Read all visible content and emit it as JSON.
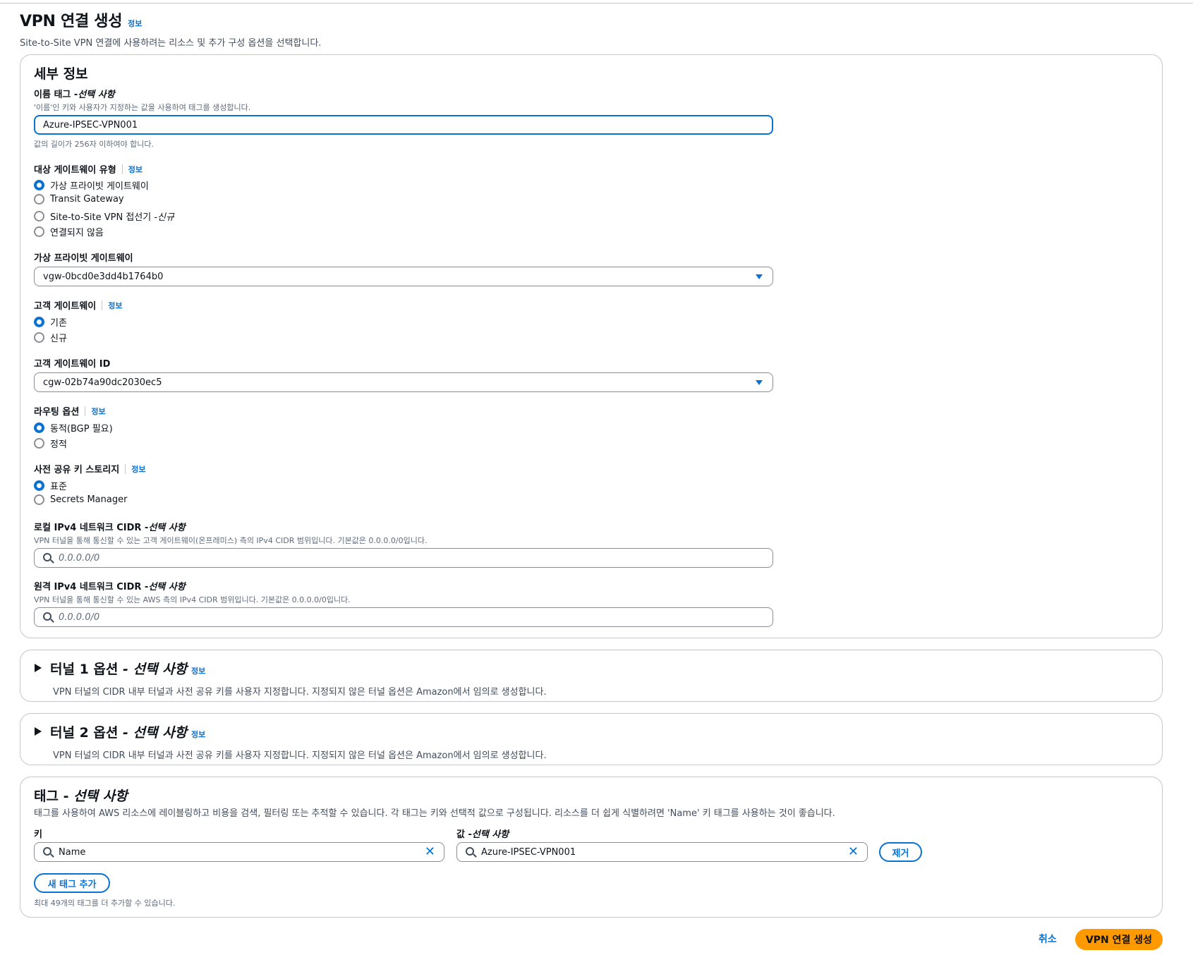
{
  "page": {
    "title": "VPN 연결 생성",
    "info": "정보",
    "description": "Site-to-Site VPN 연결에 사용하려는 리소스 및 추가 구성 옵션을 선택합니다."
  },
  "details": {
    "heading": "세부 정보",
    "name_tag": {
      "label": "이름 태그 - ",
      "optional": "선택 사항",
      "hint": "'이름'인 키와 사용자가 지정하는 값을 사용하여 태그를 생성합니다.",
      "value": "Azure-IPSEC-VPN001",
      "constraint": "값의 길이가 256자 이하여야 합니다."
    },
    "target_gateway_type": {
      "label": "대상 게이트웨이 유형",
      "info": "정보",
      "options": [
        {
          "label": "가상 프라이빗 게이트웨이",
          "suffix": "",
          "checked": true
        },
        {
          "label": "Transit Gateway",
          "suffix": "",
          "checked": false
        },
        {
          "label": "Site-to-Site VPN 접선기 - ",
          "suffix": "신규",
          "checked": false
        },
        {
          "label": "연결되지 않음",
          "suffix": "",
          "checked": false
        }
      ]
    },
    "vgw": {
      "label": "가상 프라이빗 게이트웨이",
      "value": "vgw-0bcd0e3dd4b1764b0"
    },
    "customer_gateway": {
      "label": "고객 게이트웨이",
      "info": "정보",
      "options": [
        {
          "label": "기존",
          "checked": true
        },
        {
          "label": "신규",
          "checked": false
        }
      ]
    },
    "cgw_id": {
      "label": "고객 게이트웨이 ID",
      "value": "cgw-02b74a90dc2030ec5"
    },
    "routing": {
      "label": "라우팅 옵션",
      "info": "정보",
      "options": [
        {
          "label": "동적(BGP 필요)",
          "checked": true
        },
        {
          "label": "정적",
          "checked": false
        }
      ]
    },
    "psk_storage": {
      "label": "사전 공유 키 스토리지",
      "info": "정보",
      "options": [
        {
          "label": "표준",
          "checked": true
        },
        {
          "label": "Secrets Manager",
          "checked": false
        }
      ]
    },
    "local_cidr": {
      "label": "로컬 IPv4 네트워크 CIDR - ",
      "optional": "선택 사항",
      "hint": "VPN 터널을 통해 통신할 수 있는 고객 게이트웨이(온프레미스) 측의 IPv4 CIDR 범위입니다. 기본값은 0.0.0.0/0입니다.",
      "placeholder": "0.0.0.0/0"
    },
    "remote_cidr": {
      "label": "원격 IPv4 네트워크 CIDR - ",
      "optional": "선택 사항",
      "hint": "VPN 터널을 통해 통신할 수 있는 AWS 측의 IPv4 CIDR 범위입니다. 기본값은 0.0.0.0/0입니다.",
      "placeholder": "0.0.0.0/0"
    }
  },
  "tunnel1": {
    "title": "터널 1 옵션",
    "optional": " - 선택 사항",
    "info": "정보",
    "description": "VPN 터널의 CIDR 내부 터널과 사전 공유 키를 사용자 지정합니다. 지정되지 않은 터널 옵션은 Amazon에서 임의로 생성합니다."
  },
  "tunnel2": {
    "title": "터널 2 옵션",
    "optional": " - 선택 사항",
    "info": "정보",
    "description": "VPN 터널의 CIDR 내부 터널과 사전 공유 키를 사용자 지정합니다. 지정되지 않은 터널 옵션은 Amazon에서 임의로 생성합니다."
  },
  "tags": {
    "heading": "태그 - ",
    "optional": "선택 사항",
    "description": "태그를 사용하여 AWS 리소스에 레이블링하고 비용을 검색, 필터링 또는 추적할 수 있습니다. 각 태그는 키와 선택적 값으로 구성됩니다. 리소스를 더 쉽게 식별하려면 'Name' 키 태그를 사용하는 것이 좋습니다.",
    "key_label": "키",
    "value_label": "값 - ",
    "value_optional": "선택 사항",
    "key_value": "Name",
    "value_value": "Azure-IPSEC-VPN001",
    "remove_label": "제거",
    "add_label": "새 태그 추가",
    "limit_text": "최대 49개의 태그를 더 추가할 수 있습니다."
  },
  "footer": {
    "cancel_label": "취소",
    "create_label": "VPN 연결 생성"
  },
  "colors": {
    "accent": "#0972d3",
    "primary_button": "#ff9900",
    "border": "#c6c6cd"
  }
}
